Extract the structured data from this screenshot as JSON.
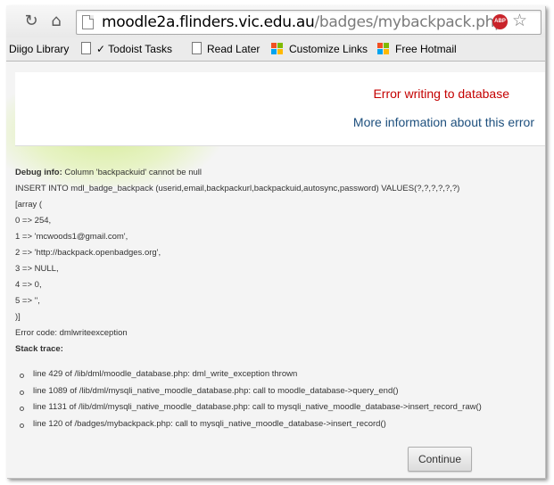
{
  "browser": {
    "url_host": "moodle2a.flinders.vic.edu.au",
    "url_path": "/badges/mybackpack.php",
    "abp_label": "ABP"
  },
  "bookmarks": [
    {
      "label": "Diigo Library"
    },
    {
      "label": "✓ Todoist Tasks"
    },
    {
      "label": "Read Later"
    },
    {
      "label": "Customize Links"
    },
    {
      "label": "Free Hotmail"
    }
  ],
  "error": {
    "title": "Error writing to database",
    "more_info_link": "More information about this error"
  },
  "debug": {
    "info_label": "Debug info:",
    "info_text": " Column 'backpackuid' cannot be null",
    "lines": [
      "INSERT INTO mdl_badge_backpack (userid,email,backpackurl,backpackuid,autosync,password) VALUES(?,?,?,?,?,?)",
      "[array (",
      "0 => 254,",
      "1 => 'mcwoods1@gmail.com',",
      "2 => 'http://backpack.openbadges.org',",
      "3 => NULL,",
      "4 => 0,",
      "5 => '',",
      ")]",
      "Error code: dmlwriteexception"
    ],
    "stack_label": "Stack trace:"
  },
  "stack_trace": [
    "line 429 of /lib/dml/moodle_database.php: dml_write_exception thrown",
    "line 1089 of /lib/dml/mysqli_native_moodle_database.php: call to moodle_database->query_end()",
    "line 1131 of /lib/dml/mysqli_native_moodle_database.php: call to mysqli_native_moodle_database->insert_record_raw()",
    "line 120 of /badges/mybackpack.php: call to mysqli_native_moodle_database->insert_record()"
  ],
  "continue_label": "Continue",
  "colors": {
    "error_red": "#c40000",
    "link_blue": "#1d4f7d"
  }
}
